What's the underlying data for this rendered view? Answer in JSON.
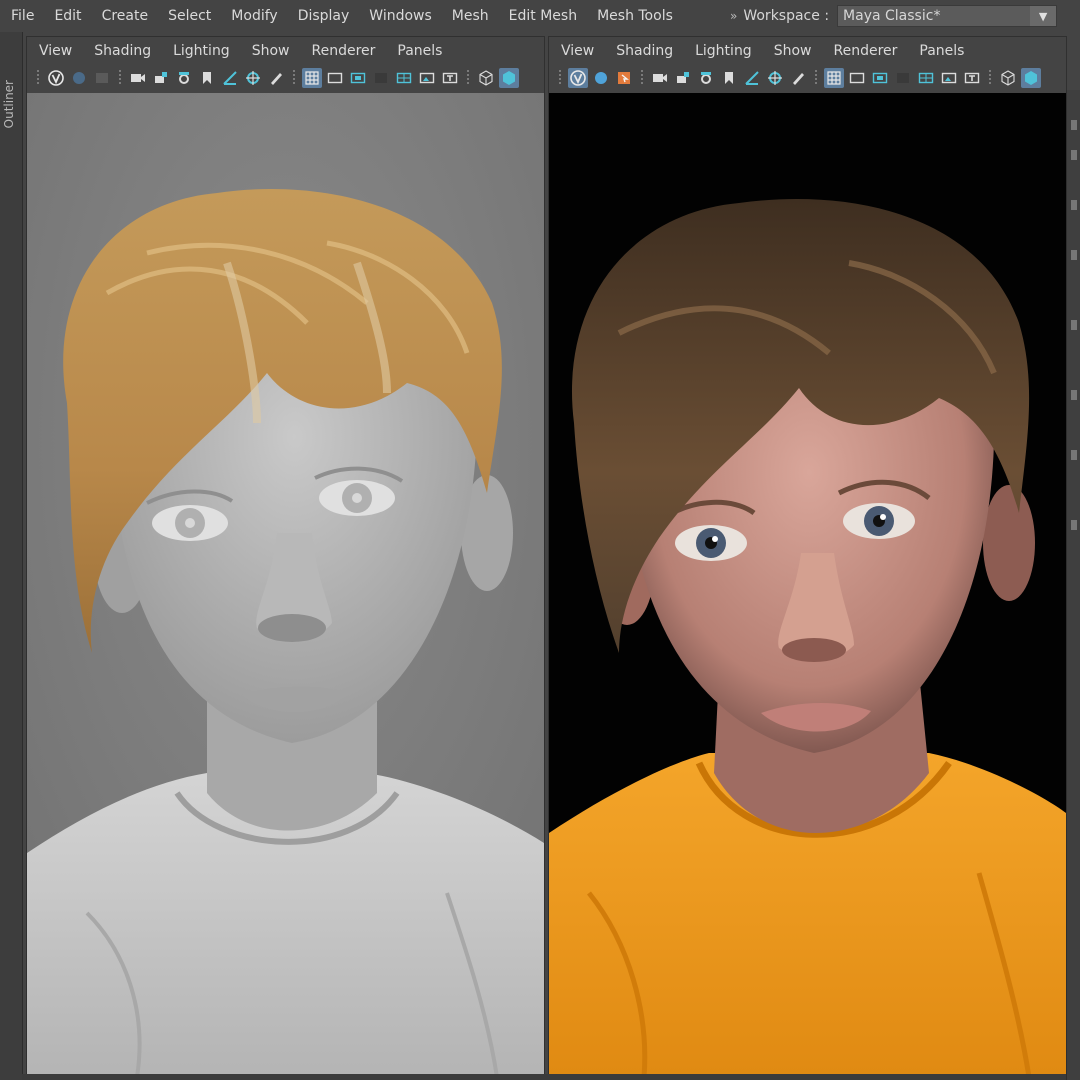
{
  "menubar": {
    "items": [
      "File",
      "Edit",
      "Create",
      "Select",
      "Modify",
      "Display",
      "Windows",
      "Mesh",
      "Edit Mesh",
      "Mesh Tools"
    ]
  },
  "workspace": {
    "label": "Workspace :",
    "value": "Maya Classic*"
  },
  "outliner": {
    "label": "Outliner"
  },
  "panels": [
    {
      "menu": [
        "View",
        "Shading",
        "Lighting",
        "Show",
        "Renderer",
        "Panels"
      ],
      "viewport": {
        "content": "grey-shaded-3d-render",
        "background": "#777777"
      }
    },
    {
      "menu": [
        "View",
        "Shading",
        "Lighting",
        "Show",
        "Renderer",
        "Panels"
      ],
      "viewport": {
        "content": "reference-photo",
        "background": "#000000"
      }
    }
  ],
  "colors": {
    "ui_bg": "#444444",
    "accent_blue": "#5d7e9e",
    "icon_cyan": "#4fc3d9",
    "shirt_orange": "#f09a1e",
    "hair_blond": "#b88a4c",
    "hair_brown": "#6a4e34"
  }
}
